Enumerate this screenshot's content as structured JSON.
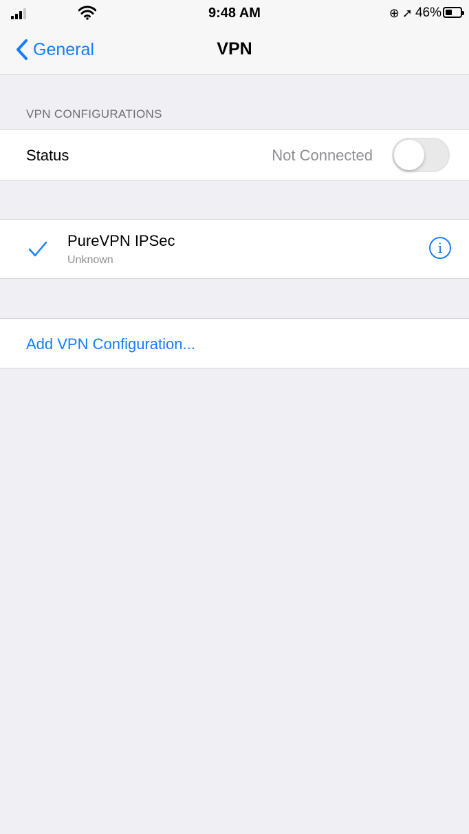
{
  "status_bar": {
    "time": "9:48 AM",
    "battery": "46%",
    "battery_level": 0.46,
    "icons": [
      "signal-icon",
      "wifi-icon",
      "orientation-lock-icon",
      "location-icon",
      "battery-icon"
    ]
  },
  "nav": {
    "back_label": "General",
    "title": "VPN"
  },
  "section": {
    "header": "VPN CONFIGURATIONS"
  },
  "status_row": {
    "label": "Status",
    "value": "Not Connected",
    "toggle_on": false
  },
  "vpn": {
    "name": "PureVPN IPSec",
    "subtitle": "Unknown",
    "selected": true
  },
  "add": {
    "label": "Add VPN Configuration..."
  },
  "colors": {
    "accent": "#147efb",
    "background": "#efeff4",
    "secondary_text": "#8e8e93"
  }
}
